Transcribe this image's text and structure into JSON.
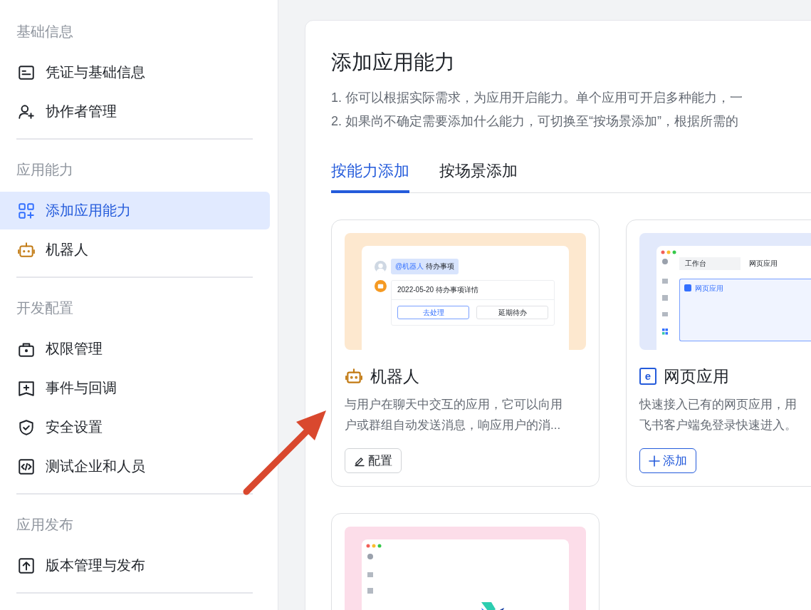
{
  "sidebar": {
    "groups": [
      {
        "heading": "基础信息",
        "items": [
          {
            "label": "凭证与基础信息",
            "kind": "credential",
            "selected": false
          },
          {
            "label": "协作者管理",
            "kind": "member",
            "selected": false
          }
        ]
      },
      {
        "heading": "应用能力",
        "items": [
          {
            "label": "添加应用能力",
            "kind": "capability",
            "selected": true
          },
          {
            "label": "机器人",
            "kind": "robot",
            "selected": false
          }
        ]
      },
      {
        "heading": "开发配置",
        "items": [
          {
            "label": "权限管理",
            "kind": "permission",
            "selected": false
          },
          {
            "label": "事件与回调",
            "kind": "event",
            "selected": false
          },
          {
            "label": "安全设置",
            "kind": "security",
            "selected": false
          },
          {
            "label": "测试企业和人员",
            "kind": "testing",
            "selected": false
          }
        ]
      },
      {
        "heading": "应用发布",
        "items": [
          {
            "label": "版本管理与发布",
            "kind": "release",
            "selected": false
          }
        ]
      }
    ]
  },
  "panel": {
    "title": "添加应用能力",
    "description": [
      "1. 你可以根据实际需求，为应用开启能力。单个应用可开启多种能力，一",
      "2. 如果尚不确定需要添加什么能力，可切换至“按场景添加”，根据所需的"
    ],
    "tabs": [
      {
        "label": "按能力添加",
        "selected": true
      },
      {
        "label": "按场景添加",
        "selected": false
      }
    ],
    "cards": [
      {
        "kind": "robot",
        "title": "机器人",
        "description": [
          "与用户在聊天中交互的应用，它可以向用",
          "户或群组自动发送消息，响应用户的消..."
        ],
        "button": {
          "kind": "configure",
          "label": "配置"
        },
        "preview": {
          "kind": "chat",
          "mention": "@机器人",
          "message": "待办事项",
          "card_title": "2022-05-20 待办事项详情",
          "actions": [
            "去处理",
            "延期待办"
          ]
        }
      },
      {
        "kind": "webapp",
        "title": "网页应用",
        "badge": "e",
        "description": [
          "快速接入已有的网页应用，用",
          "飞书客户端免登录快速进入。"
        ],
        "button": {
          "kind": "add",
          "label": "添加"
        },
        "preview": {
          "kind": "window",
          "tabs": [
            "工作台",
            "网页应用"
          ],
          "panel_title": "网页应用"
        }
      },
      {
        "kind": "other",
        "preview": {
          "kind": "logo"
        }
      }
    ]
  },
  "annotation": {
    "kind": "arrow"
  }
}
